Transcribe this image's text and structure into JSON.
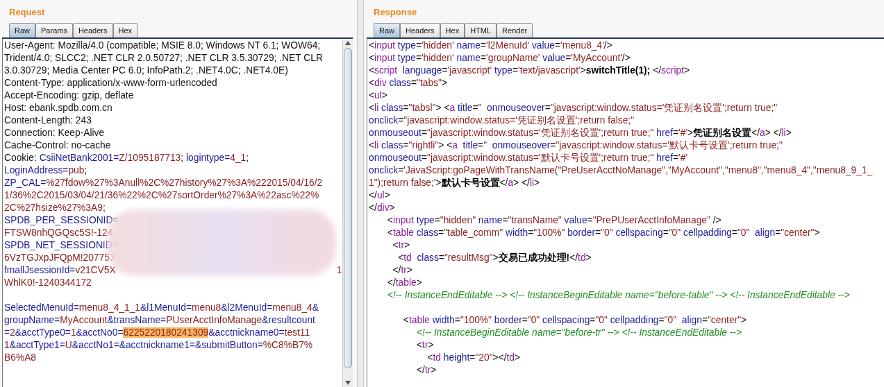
{
  "request": {
    "title": "Request",
    "tabs": [
      {
        "label": "Raw",
        "selected": true
      },
      {
        "label": "Params",
        "selected": false
      },
      {
        "label": "Headers",
        "selected": false
      },
      {
        "label": "Hex",
        "selected": false
      }
    ],
    "lines": [
      {
        "segments": [
          {
            "kind": "p",
            "text": "User-Agent: Mozilla/4.0 (compatible; MSIE 8.0; Windows NT 6.1; WOW64;"
          }
        ]
      },
      {
        "segments": [
          {
            "kind": "p",
            "text": "Trident/4.0; SLCC2; .NET CLR 2.0.50727; .NET CLR 3.5.30729; .NET CLR"
          }
        ]
      },
      {
        "segments": [
          {
            "kind": "p",
            "text": "3.0.30729; Media Center PC 6.0; InfoPath.2; .NET4.0C; .NET4.0E)"
          }
        ]
      },
      {
        "segments": [
          {
            "kind": "p",
            "text": "Content-Type: application/x-www-form-urlencoded"
          }
        ]
      },
      {
        "segments": [
          {
            "kind": "p",
            "text": "Accept-Encoding: gzip, deflate"
          }
        ]
      },
      {
        "segments": [
          {
            "kind": "p",
            "text": "Host: ebank.spdb.com.cn"
          }
        ]
      },
      {
        "segments": [
          {
            "kind": "p",
            "text": "Content-Length: 243"
          }
        ]
      },
      {
        "segments": [
          {
            "kind": "p",
            "text": "Connection: Keep-Alive"
          }
        ]
      },
      {
        "segments": [
          {
            "kind": "p",
            "text": "Cache-Control: no-cache"
          }
        ]
      },
      {
        "segments": [
          {
            "kind": "p",
            "text": "Cookie: "
          },
          {
            "kind": "key",
            "text": "CsiiNetBank2001="
          },
          {
            "kind": "val",
            "text": "Z/1095187713"
          },
          {
            "kind": "p",
            "text": "; "
          },
          {
            "kind": "key",
            "text": "logintype="
          },
          {
            "kind": "val",
            "text": "4_1"
          },
          {
            "kind": "p",
            "text": ";"
          }
        ]
      },
      {
        "segments": [
          {
            "kind": "key",
            "text": "LoginAddress="
          },
          {
            "kind": "val",
            "text": "pub"
          },
          {
            "kind": "p",
            "text": ";"
          }
        ]
      },
      {
        "segments": [
          {
            "kind": "key",
            "text": "ZP_CAL="
          },
          {
            "kind": "val",
            "text": "%27fdow%27%3Anull%2C%27history%27%3A%222015/04/16/2"
          }
        ]
      },
      {
        "segments": [
          {
            "kind": "val",
            "text": "1/36%2C2015/03/04/21/36%22%2C%27sortOrder%27%3A%22asc%22%"
          }
        ]
      },
      {
        "segments": [
          {
            "kind": "val",
            "text": "2C%27hsize%27%3A9"
          },
          {
            "kind": "p",
            "text": ";"
          }
        ]
      },
      {
        "segments": [
          {
            "kind": "key",
            "text": "SPDB_PER_SESSIONID="
          }
        ]
      },
      {
        "segments": [
          {
            "kind": "val",
            "text": "FTSW8nhQGQsc5S!-124"
          }
        ]
      },
      {
        "segments": [
          {
            "kind": "key",
            "text": "SPDB_NET_SESSIONID="
          }
        ]
      },
      {
        "segments": [
          {
            "kind": "val",
            "text": "6VzTGJxpJFQpM!207757"
          }
        ]
      },
      {
        "segments": [
          {
            "kind": "key",
            "text": "fmallJsessionId="
          },
          {
            "kind": "val",
            "text": "v21CV5X"
          },
          {
            "kind": "gap"
          },
          {
            "kind": "val",
            "text": "1"
          }
        ]
      },
      {
        "segments": [
          {
            "kind": "val",
            "text": "WhlK0!-1240344172"
          }
        ]
      },
      {
        "space_before": true,
        "segments": [
          {
            "kind": "key",
            "text": "SelectedMenuId="
          },
          {
            "kind": "val",
            "text": "menu8_4_1_1"
          },
          {
            "kind": "key",
            "text": "&l1MenuId="
          },
          {
            "kind": "val",
            "text": "menu8"
          },
          {
            "kind": "key",
            "text": "&l2MenuId="
          },
          {
            "kind": "val",
            "text": "menu8_4"
          },
          {
            "kind": "key",
            "text": "&"
          }
        ]
      },
      {
        "segments": [
          {
            "kind": "key",
            "text": "groupName="
          },
          {
            "kind": "val",
            "text": "MyAccount"
          },
          {
            "kind": "key",
            "text": "&transName="
          },
          {
            "kind": "val",
            "text": "PUserAcctInfoManage"
          },
          {
            "kind": "key",
            "text": "&resultcount"
          }
        ]
      },
      {
        "segments": [
          {
            "kind": "key",
            "text": "="
          },
          {
            "kind": "val",
            "text": "2"
          },
          {
            "kind": "key",
            "text": "&acctType0="
          },
          {
            "kind": "val",
            "text": "1"
          },
          {
            "kind": "key",
            "text": "&acctNo0="
          },
          {
            "kind": "hl",
            "text": "6225220180241309"
          },
          {
            "kind": "key",
            "text": "&acctnickname0="
          },
          {
            "kind": "val",
            "text": "test11"
          }
        ]
      },
      {
        "segments": [
          {
            "kind": "val",
            "text": "1"
          },
          {
            "kind": "key",
            "text": "&acctType1="
          },
          {
            "kind": "val",
            "text": "U"
          },
          {
            "kind": "key",
            "text": "&acctNo1=&acctnickname1=&submitButton="
          },
          {
            "kind": "val",
            "text": "%C8%B7%"
          }
        ]
      },
      {
        "segments": [
          {
            "kind": "val",
            "text": "B6%A8"
          }
        ]
      }
    ]
  },
  "response": {
    "title": "Response",
    "tabs": [
      {
        "label": "Raw",
        "selected": true
      },
      {
        "label": "Headers",
        "selected": false
      },
      {
        "label": "Hex",
        "selected": false
      },
      {
        "label": "HTML",
        "selected": false
      },
      {
        "label": "Render",
        "selected": false
      }
    ],
    "lines": [
      {
        "segments": [
          {
            "kind": "p",
            "text": "<"
          },
          {
            "kind": "tag",
            "text": "input"
          },
          {
            "kind": "attr",
            "text": " type"
          },
          {
            "kind": "p",
            "text": "="
          },
          {
            "kind": "str",
            "text": "'hidden'"
          },
          {
            "kind": "attr",
            "text": " name"
          },
          {
            "kind": "p",
            "text": "="
          },
          {
            "kind": "str",
            "text": "'l2MenuId'"
          },
          {
            "kind": "attr",
            "text": " value"
          },
          {
            "kind": "p",
            "text": "="
          },
          {
            "kind": "str",
            "text": "'menu8_4'"
          },
          {
            "kind": "p",
            "text": "/>"
          }
        ]
      },
      {
        "segments": [
          {
            "kind": "p",
            "text": "<"
          },
          {
            "kind": "tag",
            "text": "input"
          },
          {
            "kind": "attr",
            "text": " type"
          },
          {
            "kind": "p",
            "text": "="
          },
          {
            "kind": "str",
            "text": "'hidden'"
          },
          {
            "kind": "attr",
            "text": " name"
          },
          {
            "kind": "p",
            "text": "="
          },
          {
            "kind": "str",
            "text": "'groupName'"
          },
          {
            "kind": "attr",
            "text": " value"
          },
          {
            "kind": "p",
            "text": "="
          },
          {
            "kind": "str",
            "text": "'MyAccount'"
          },
          {
            "kind": "p",
            "text": "/>"
          }
        ]
      },
      {
        "segments": [
          {
            "kind": "p",
            "text": "<"
          },
          {
            "kind": "tag",
            "text": "script"
          },
          {
            "kind": "attr",
            "text": "  language"
          },
          {
            "kind": "p",
            "text": "="
          },
          {
            "kind": "str",
            "text": "'javascript'"
          },
          {
            "kind": "attr",
            "text": " type"
          },
          {
            "kind": "p",
            "text": "="
          },
          {
            "kind": "str",
            "text": "'text/javascript'"
          },
          {
            "kind": "p",
            "text": ">"
          },
          {
            "kind": "b",
            "text": "switchTitle(1);"
          },
          {
            "kind": "p",
            "text": " </"
          },
          {
            "kind": "tag",
            "text": "script"
          },
          {
            "kind": "p",
            "text": ">"
          }
        ]
      },
      {
        "segments": [
          {
            "kind": "p",
            "text": "<"
          },
          {
            "kind": "tag",
            "text": "div"
          },
          {
            "kind": "attr",
            "text": " class"
          },
          {
            "kind": "p",
            "text": "="
          },
          {
            "kind": "str",
            "text": "\"tabs\""
          },
          {
            "kind": "p",
            "text": ">"
          }
        ]
      },
      {
        "segments": [
          {
            "kind": "p",
            "text": "<"
          },
          {
            "kind": "tag",
            "text": "ul"
          },
          {
            "kind": "p",
            "text": ">"
          }
        ]
      },
      {
        "segments": [
          {
            "kind": "p",
            "text": "<"
          },
          {
            "kind": "tag",
            "text": "li"
          },
          {
            "kind": "attr",
            "text": " class"
          },
          {
            "kind": "p",
            "text": "="
          },
          {
            "kind": "str",
            "text": "\"tabsl\""
          },
          {
            "kind": "p",
            "text": "> <"
          },
          {
            "kind": "tag",
            "text": "a"
          },
          {
            "kind": "attr",
            "text": " title"
          },
          {
            "kind": "p",
            "text": "="
          },
          {
            "kind": "str",
            "text": "\"  "
          },
          {
            "kind": "attr",
            "text": "onmouseover"
          },
          {
            "kind": "p",
            "text": "="
          },
          {
            "kind": "str",
            "text": "\"javascript:window.status='凭证别名设置';return true;\""
          }
        ]
      },
      {
        "segments": [
          {
            "kind": "attr",
            "text": "onclick"
          },
          {
            "kind": "p",
            "text": "="
          },
          {
            "kind": "str",
            "text": "\"javascript:window.status='凭证别名设置';return false;\""
          }
        ]
      },
      {
        "segments": [
          {
            "kind": "attr",
            "text": "onmouseout"
          },
          {
            "kind": "p",
            "text": "="
          },
          {
            "kind": "str",
            "text": "\"javascript:window.status='凭证别名设置';return true;\""
          },
          {
            "kind": "attr",
            "text": " href"
          },
          {
            "kind": "p",
            "text": "="
          },
          {
            "kind": "str",
            "text": "'#'"
          },
          {
            "kind": "p",
            "text": ">"
          },
          {
            "kind": "b",
            "text": "凭证别名设置"
          },
          {
            "kind": "p",
            "text": "</"
          },
          {
            "kind": "tag",
            "text": "a"
          },
          {
            "kind": "p",
            "text": "> </"
          },
          {
            "kind": "tag",
            "text": "li"
          },
          {
            "kind": "p",
            "text": ">"
          }
        ]
      },
      {
        "segments": [
          {
            "kind": "p",
            "text": "<"
          },
          {
            "kind": "tag",
            "text": "li"
          },
          {
            "kind": "attr",
            "text": " class"
          },
          {
            "kind": "p",
            "text": "="
          },
          {
            "kind": "str",
            "text": "\"rightli\""
          },
          {
            "kind": "p",
            "text": "> <"
          },
          {
            "kind": "tag",
            "text": "a"
          },
          {
            "kind": "attr",
            "text": "  title"
          },
          {
            "kind": "p",
            "text": "="
          },
          {
            "kind": "str",
            "text": "\"  "
          },
          {
            "kind": "attr",
            "text": "onmouseover"
          },
          {
            "kind": "p",
            "text": "="
          },
          {
            "kind": "str",
            "text": "\"javascript:window.status='默认卡号设置';return true;\""
          }
        ]
      },
      {
        "segments": [
          {
            "kind": "attr",
            "text": "onmouseout"
          },
          {
            "kind": "p",
            "text": "="
          },
          {
            "kind": "str",
            "text": "\"javascript:window.status='默认卡号设置';return true;\""
          },
          {
            "kind": "attr",
            "text": " href"
          },
          {
            "kind": "p",
            "text": "="
          },
          {
            "kind": "str",
            "text": "'#'"
          }
        ]
      },
      {
        "segments": [
          {
            "kind": "attr",
            "text": "onclick"
          },
          {
            "kind": "p",
            "text": "="
          },
          {
            "kind": "str",
            "text": "'JavaScript:goPageWithTransName(\"PreUserAcctNoManage\",\"MyAccount\",\"menu8\",\"menu8_4\",\"menu8_9_1_"
          }
        ]
      },
      {
        "segments": [
          {
            "kind": "str",
            "text": "1\");return false;'"
          },
          {
            "kind": "p",
            "text": ">"
          },
          {
            "kind": "b",
            "text": "默认卡号设置"
          },
          {
            "kind": "p",
            "text": "</"
          },
          {
            "kind": "tag",
            "text": "a"
          },
          {
            "kind": "p",
            "text": "> </"
          },
          {
            "kind": "tag",
            "text": "li"
          },
          {
            "kind": "p",
            "text": ">"
          }
        ]
      },
      {
        "segments": [
          {
            "kind": "p",
            "text": "</"
          },
          {
            "kind": "tag",
            "text": "ul"
          },
          {
            "kind": "p",
            "text": ">"
          }
        ]
      },
      {
        "segments": [
          {
            "kind": "p",
            "text": "</"
          },
          {
            "kind": "tag",
            "text": "div"
          },
          {
            "kind": "p",
            "text": ">"
          }
        ]
      },
      {
        "segments": [
          {
            "kind": "p",
            "text": "       <"
          },
          {
            "kind": "tag",
            "text": "input"
          },
          {
            "kind": "attr",
            "text": " type"
          },
          {
            "kind": "p",
            "text": "="
          },
          {
            "kind": "str",
            "text": "\"hidden\""
          },
          {
            "kind": "attr",
            "text": " name"
          },
          {
            "kind": "p",
            "text": "="
          },
          {
            "kind": "str",
            "text": "\"transName\""
          },
          {
            "kind": "attr",
            "text": " value"
          },
          {
            "kind": "p",
            "text": "="
          },
          {
            "kind": "str",
            "text": "\"PrePUserAcctInfoManage\""
          },
          {
            "kind": "p",
            "text": " />"
          }
        ]
      },
      {
        "segments": [
          {
            "kind": "p",
            "text": "       <"
          },
          {
            "kind": "tag",
            "text": "table"
          },
          {
            "kind": "attr",
            "text": " class"
          },
          {
            "kind": "p",
            "text": "="
          },
          {
            "kind": "str",
            "text": "\"table_comm\""
          },
          {
            "kind": "attr",
            "text": " width"
          },
          {
            "kind": "p",
            "text": "="
          },
          {
            "kind": "str",
            "text": "\"100%\""
          },
          {
            "kind": "attr",
            "text": " border"
          },
          {
            "kind": "p",
            "text": "="
          },
          {
            "kind": "str",
            "text": "\"0\""
          },
          {
            "kind": "attr",
            "text": " cellspacing"
          },
          {
            "kind": "p",
            "text": "="
          },
          {
            "kind": "str",
            "text": "\"0\""
          },
          {
            "kind": "attr",
            "text": " cellpadding"
          },
          {
            "kind": "p",
            "text": "="
          },
          {
            "kind": "str",
            "text": "\"0\""
          },
          {
            "kind": "attr",
            "text": "  align"
          },
          {
            "kind": "p",
            "text": "="
          },
          {
            "kind": "str",
            "text": "\"center\""
          },
          {
            "kind": "p",
            "text": ">"
          }
        ]
      },
      {
        "segments": [
          {
            "kind": "p",
            "text": "         <"
          },
          {
            "kind": "tag",
            "text": "tr"
          },
          {
            "kind": "p",
            "text": ">"
          }
        ]
      },
      {
        "segments": [
          {
            "kind": "p",
            "text": "           <"
          },
          {
            "kind": "tag",
            "text": "td"
          },
          {
            "kind": "attr",
            "text": "  class"
          },
          {
            "kind": "p",
            "text": "="
          },
          {
            "kind": "str",
            "text": "\"resultMsg\""
          },
          {
            "kind": "p",
            "text": ">"
          },
          {
            "kind": "b",
            "text": "交易已成功处理!"
          },
          {
            "kind": "p",
            "text": "</"
          },
          {
            "kind": "tag",
            "text": "td"
          },
          {
            "kind": "p",
            "text": ">"
          }
        ]
      },
      {
        "segments": [
          {
            "kind": "p",
            "text": "         </"
          },
          {
            "kind": "tag",
            "text": "tr"
          },
          {
            "kind": "p",
            "text": ">"
          }
        ]
      },
      {
        "segments": [
          {
            "kind": "p",
            "text": "       </"
          },
          {
            "kind": "tag",
            "text": "table"
          },
          {
            "kind": "p",
            "text": ">"
          }
        ]
      },
      {
        "segments": [
          {
            "kind": "cm",
            "text": "       <!-- InstanceEndEditable --> <!-- InstanceBeginEditable name=\"before-table\" --> <!-- InstanceEndEditable -->"
          }
        ]
      },
      {
        "space_before": true,
        "segments": [
          {
            "kind": "p",
            "text": "             <"
          },
          {
            "kind": "tag",
            "text": "table"
          },
          {
            "kind": "attr",
            "text": " width"
          },
          {
            "kind": "p",
            "text": "="
          },
          {
            "kind": "str",
            "text": "\"100%\""
          },
          {
            "kind": "attr",
            "text": " border"
          },
          {
            "kind": "p",
            "text": "="
          },
          {
            "kind": "str",
            "text": "\"0\""
          },
          {
            "kind": "attr",
            "text": " cellspacing"
          },
          {
            "kind": "p",
            "text": "="
          },
          {
            "kind": "str",
            "text": "\"0\""
          },
          {
            "kind": "attr",
            "text": " cellpadding"
          },
          {
            "kind": "p",
            "text": "="
          },
          {
            "kind": "str",
            "text": "\"0\""
          },
          {
            "kind": "attr",
            "text": "  align"
          },
          {
            "kind": "p",
            "text": "="
          },
          {
            "kind": "str",
            "text": "\"center\""
          },
          {
            "kind": "p",
            "text": ">"
          }
        ]
      },
      {
        "segments": [
          {
            "kind": "cm",
            "text": "                  <!-- InstanceBeginEditable name=\"before-tr\" --> <!-- InstanceEndEditable -->"
          }
        ]
      },
      {
        "segments": [
          {
            "kind": "p",
            "text": "                  <"
          },
          {
            "kind": "tag",
            "text": "tr"
          },
          {
            "kind": "p",
            "text": ">"
          }
        ]
      },
      {
        "segments": [
          {
            "kind": "p",
            "text": "                      <"
          },
          {
            "kind": "tag",
            "text": "td"
          },
          {
            "kind": "attr",
            "text": " height"
          },
          {
            "kind": "p",
            "text": "="
          },
          {
            "kind": "str",
            "text": "\"20\""
          },
          {
            "kind": "p",
            "text": "></"
          },
          {
            "kind": "tag",
            "text": "td"
          },
          {
            "kind": "p",
            "text": ">"
          }
        ]
      },
      {
        "segments": [
          {
            "kind": "p",
            "text": "                  </"
          },
          {
            "kind": "tag",
            "text": "tr"
          },
          {
            "kind": "p",
            "text": ">"
          }
        ]
      }
    ]
  }
}
